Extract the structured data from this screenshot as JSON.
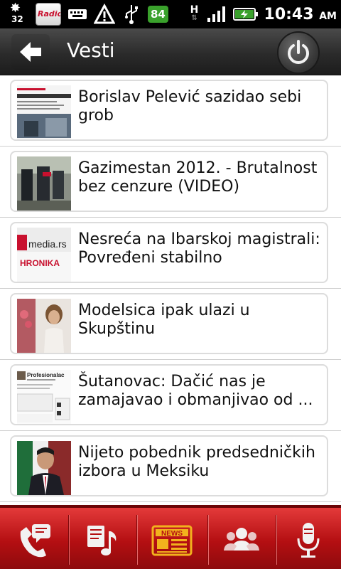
{
  "statusbar": {
    "weather_temp": "32",
    "radio_icon_text": "RadioS",
    "battery_percent": "84",
    "network_type": "H",
    "time": "10:43",
    "ampm": "AM"
  },
  "header": {
    "title": "Vesti"
  },
  "news": [
    {
      "title": "Borislav Pelević sazidao sebi grob",
      "thumb_icon": "news-thumbnail-pelevic"
    },
    {
      "title": "Gazimestan 2012. - Brutalnost bez cenzure (VIDEO)",
      "thumb_icon": "news-thumbnail-gazimestan"
    },
    {
      "title": "Nesreća na Ibarskoj magistrali: Povređeni stabilno",
      "thumb_icon": "news-thumbnail-media-rs-hronika",
      "thumb_text_top": "media.rs",
      "thumb_text_bottom": "HRONIKA"
    },
    {
      "title": "Modelsica ipak ulazi u Skupštinu",
      "thumb_icon": "news-thumbnail-model"
    },
    {
      "title": "Šutanovac: Dačić nas je zamajavao i obmanjivao od  ...",
      "thumb_icon": "news-thumbnail-twitter",
      "thumb_text_top": "Profesionalac"
    },
    {
      "title": "Nijeto pobednik predsedničkih izbora u Meksiku",
      "thumb_icon": "news-thumbnail-nieto"
    }
  ],
  "bottom_nav": [
    {
      "icon": "phone-chat-icon"
    },
    {
      "icon": "music-notes-icon"
    },
    {
      "icon": "news-icon",
      "label": "NEWS"
    },
    {
      "icon": "people-icon"
    },
    {
      "icon": "microphone-icon"
    }
  ],
  "colors": {
    "accent_red": "#c8102e",
    "news_gold": "#f2b21d",
    "battery_green": "#3aa12c"
  }
}
